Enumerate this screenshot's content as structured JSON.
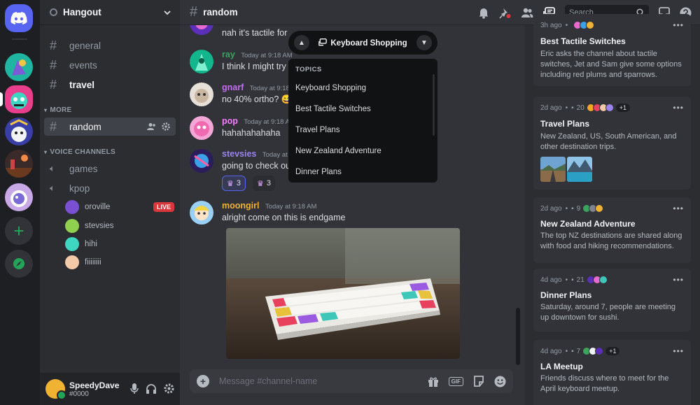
{
  "guild": {
    "name": "Hangout"
  },
  "channels": [
    {
      "name": "general"
    },
    {
      "name": "events"
    },
    {
      "name": "travel"
    }
  ],
  "categories": {
    "more": "MORE",
    "voice": "VOICE CHANNELS"
  },
  "more_channels": [
    {
      "name": "random"
    }
  ],
  "voice_channels": [
    {
      "name": "games"
    },
    {
      "name": "kpop"
    }
  ],
  "voice_users": [
    {
      "name": "oroville",
      "badge": "LIVE"
    },
    {
      "name": "stevsies"
    },
    {
      "name": "hihi"
    },
    {
      "name": "fiiiiiiii"
    }
  ],
  "user": {
    "name": "SpeedyDave",
    "tag": "#0000"
  },
  "topbar": {
    "channel": "random",
    "search_placeholder": "Search"
  },
  "messages": [
    {
      "author": "",
      "time": "",
      "text": "nah it's tactile for"
    },
    {
      "author": "ray",
      "time": "Today at 9:18 AM",
      "text": "I think I might try",
      "color": "#3ba55c"
    },
    {
      "author": "gnarf",
      "time": "Today at 9:18",
      "text": "no 40% ortho? 😅",
      "color": "#c56cf0"
    },
    {
      "author": "pop",
      "time": "Today at 9:18 AM",
      "text": "hahahahahaha",
      "color": "#f47fff"
    },
    {
      "author": "stevsies",
      "time": "Today at 9:18",
      "text": "going to check ou",
      "color": "#9b84ee"
    },
    {
      "author": "moongirl",
      "time": "Today at 9:18 AM",
      "text": "alright come on this is endgame",
      "color": "#f0b232"
    }
  ],
  "reactions": [
    {
      "count": "3"
    },
    {
      "count": "3"
    }
  ],
  "composer": {
    "placeholder": "Message #channel-name",
    "gif": "GIF"
  },
  "topic_pill": {
    "title": "Keyboard Shopping"
  },
  "topics_menu": {
    "header": "TOPICS",
    "items": [
      "Keyboard Shopping",
      "Best Tactile Switches",
      "Travel Plans",
      "New Zealand Adventure",
      "Dinner Plans"
    ]
  },
  "topic_cards": [
    {
      "age": "3h ago",
      "title": "Best Tactile Switches",
      "desc": "Eric asks the channel about tactile switches, Jet and Sam give some options including red plums and sparrows."
    },
    {
      "age": "2d ago",
      "count": "20",
      "extra": "+1",
      "title": "Travel Plans",
      "desc": "New Zealand, US, South American, and other destination trips."
    },
    {
      "age": "2d ago",
      "count": "9",
      "title": "New Zealand Adventure",
      "desc": "The top NZ destinations are shared along with food and hiking recommendations."
    },
    {
      "age": "4d ago",
      "count": "21",
      "title": "Dinner Plans",
      "desc": "Saturday, around 7, people are meeting up downtown for sushi."
    },
    {
      "age": "4d ago",
      "count": "7",
      "extra": "+1",
      "title": "LA Meetup",
      "desc": "Friends discuss where to meet for the April keyboard meetup."
    }
  ],
  "colors": {
    "blurple": "#5865f2",
    "live_red": "#da373c",
    "online_green": "#23a559"
  }
}
